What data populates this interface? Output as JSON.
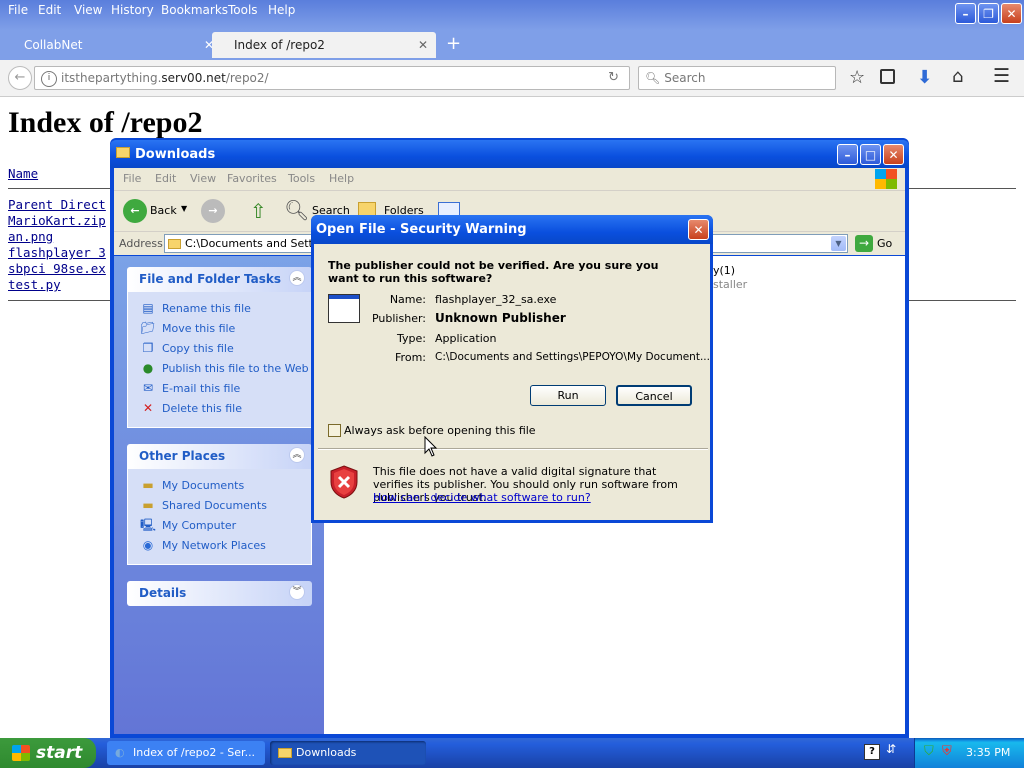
{
  "firefox": {
    "menu": [
      "File",
      "Edit",
      "View",
      "History",
      "Bookmarks",
      "Tools",
      "Help"
    ],
    "tabs": [
      {
        "label": "CollabNet",
        "active": false
      },
      {
        "label": "Index of /repo2",
        "active": true
      }
    ],
    "new_tab": "+",
    "url_prefix": "itsthepartything.",
    "url_domain": "serv00.net",
    "url_path": "/repo2/",
    "search_placeholder": "Search"
  },
  "page": {
    "heading": "Index of /repo2",
    "column_header": "Name",
    "files": [
      "Parent Direct",
      "MarioKart.zip",
      "an.png",
      "flashplayer 3",
      "sbpci 98se.ex",
      "test.py"
    ]
  },
  "explorer": {
    "title": "Downloads",
    "menu": [
      "File",
      "Edit",
      "View",
      "Favorites",
      "Tools",
      "Help"
    ],
    "toolbar": {
      "back": "Back",
      "search": "Search",
      "folders": "Folders"
    },
    "address_label": "Address",
    "address_value": "C:\\Documents and Settin",
    "go_label": "Go",
    "behind_text_1": "y(1)",
    "behind_text_2": "staller",
    "file_tasks": {
      "title": "File and Folder Tasks",
      "items": [
        "Rename this file",
        "Move this file",
        "Copy this file",
        "Publish this file to the Web",
        "E-mail this file",
        "Delete this file"
      ]
    },
    "other_places": {
      "title": "Other Places",
      "items": [
        "My Documents",
        "Shared Documents",
        "My Computer",
        "My Network Places"
      ]
    },
    "details": {
      "title": "Details"
    }
  },
  "dialog": {
    "title": "Open File - Security Warning",
    "question": "The publisher could not be verified.  Are you sure you want to run this software?",
    "fields": [
      {
        "label": "Name:",
        "value": "flashplayer_32_sa.exe"
      },
      {
        "label": "Publisher:",
        "value": "Unknown Publisher"
      },
      {
        "label": "Type:",
        "value": "Application"
      },
      {
        "label": "From:",
        "value": "C:\\Documents and Settings\\PEPOYO\\My Document..."
      }
    ],
    "run_label": "Run",
    "cancel_label": "Cancel",
    "checkbox_label": "Always ask before opening this file",
    "checkbox_checked": false,
    "warning_text": "This file does not have a valid digital signature that verifies its publisher.  You should only run software from publishers you trust.",
    "help_link": "How can I decide what software to run?"
  },
  "taskbar": {
    "start": "start",
    "tasks": [
      {
        "label": "Index of /repo2 - Ser...",
        "active": false
      },
      {
        "label": "Downloads",
        "active": true
      }
    ],
    "clock": "3:35 PM"
  },
  "colors": {
    "xp_blue": "#0a48d6",
    "panel_link": "#215dc6",
    "dialog_bg": "#ece9d8",
    "firefox_title": "#7f9fe8"
  }
}
